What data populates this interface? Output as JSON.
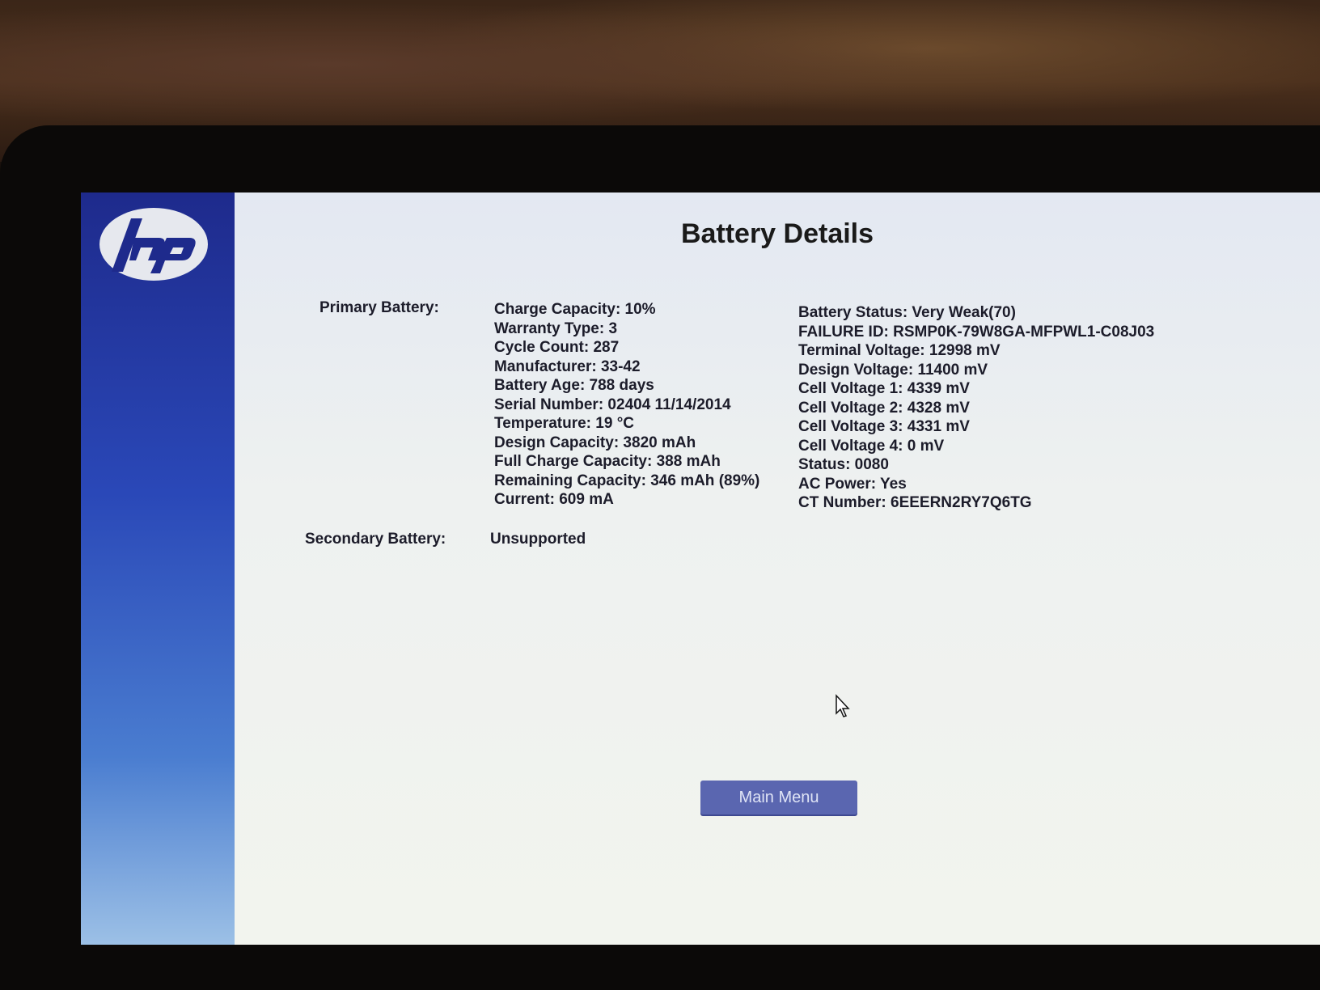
{
  "screen": {
    "title": "Battery Details",
    "logo": "hp-logo",
    "primary_battery": {
      "label": "Primary Battery:",
      "left_column": [
        "Charge Capacity: 10%",
        "Warranty Type: 3",
        "Cycle Count: 287",
        "Manufacturer: 33-42",
        "Battery Age: 788 days",
        "Serial Number: 02404 11/14/2014",
        "Temperature: 19 °C",
        "Design Capacity: 3820 mAh",
        "Full Charge Capacity: 388 mAh",
        "Remaining Capacity: 346 mAh (89%)",
        "Current: 609 mA"
      ],
      "right_column": [
        "Battery Status: Very Weak(70)",
        "FAILURE ID: RSMP0K-79W8GA-MFPWL1-C08J03",
        "Terminal Voltage: 12998 mV",
        "Design Voltage: 11400 mV",
        "Cell Voltage 1: 4339 mV",
        "Cell Voltage 2: 4328 mV",
        "Cell Voltage 3: 4331 mV",
        "Cell Voltage 4: 0 mV",
        "Status: 0080",
        "AC Power: Yes",
        "CT Number: 6EEERN2RY7Q6TG"
      ]
    },
    "secondary_battery": {
      "label": "Secondary Battery:",
      "value": "Unsupported"
    },
    "main_menu_label": "Main Menu",
    "colors": {
      "sidebar_blue": "#1e2a8c",
      "button_blue": "#5a66b0",
      "text": "#1c1c2a"
    }
  }
}
